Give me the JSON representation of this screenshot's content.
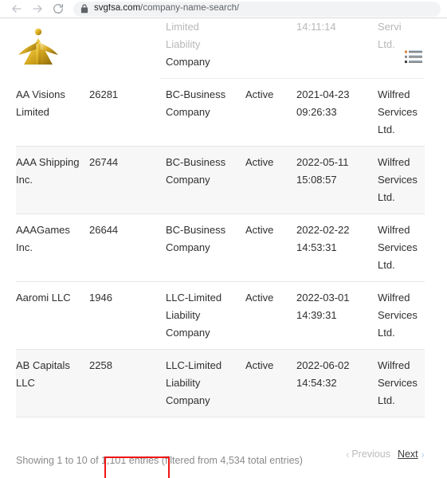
{
  "browser": {
    "back_icon": "arrow-left-icon",
    "forward_icon": "arrow-right-icon",
    "reload_icon": "reload-icon",
    "lock_icon": "lock-icon",
    "url_domain": "svgfsa.com",
    "url_path": "/company-name-search/"
  },
  "header": {
    "logo_alt": "svgfsa-logo",
    "menu_icon": "list-menu-icon"
  },
  "table": {
    "partial_row": {
      "name": "",
      "number": "",
      "type_line1": "Limited",
      "type_line2": "Liability",
      "type_line3": "Company",
      "status": "",
      "date": "14:11:14",
      "agent_line1": "Servi",
      "agent_line2": "Ltd."
    },
    "rows": [
      {
        "name": "AA Visions Limited",
        "number": "26281",
        "type": "BC-Business Company",
        "status": "Active",
        "date": "2021-04-23 09:26:33",
        "agent": "Wilfred Services Ltd."
      },
      {
        "name": "AAA Shipping Inc.",
        "number": "26744",
        "type": "BC-Business Company",
        "status": "Active",
        "date": "2022-05-11 15:08:57",
        "agent": "Wilfred Services Ltd."
      },
      {
        "name": "AAAGames Inc.",
        "number": "26644",
        "type": "BC-Business Company",
        "status": "Active",
        "date": "2022-02-22 14:53:31",
        "agent": "Wilfred Services Ltd."
      },
      {
        "name": "Aaromi LLC",
        "number": "1946",
        "type": "LLC-Limited Liability Company",
        "status": "Active",
        "date": "2022-03-01 14:39:31",
        "agent": "Wilfred Services Ltd."
      },
      {
        "name": "AB Capitals LLC",
        "number": "2258",
        "type": "LLC-Limited Liability Company",
        "status": "Active",
        "date": "2022-06-02 14:54:32",
        "agent": "Wilfred Services Ltd."
      }
    ]
  },
  "footer": {
    "info_prefix": "Showing 1 to 10 of ",
    "info_highlight": "1,101 entries",
    "info_suffix": " (filtered from 4,534 total entries)",
    "previous_label": "Previous",
    "next_label": "Next",
    "previous_chevron": "‹",
    "next_chevron": "›"
  },
  "annotation": {
    "color": "#f01414",
    "target": "1,101 entries"
  }
}
